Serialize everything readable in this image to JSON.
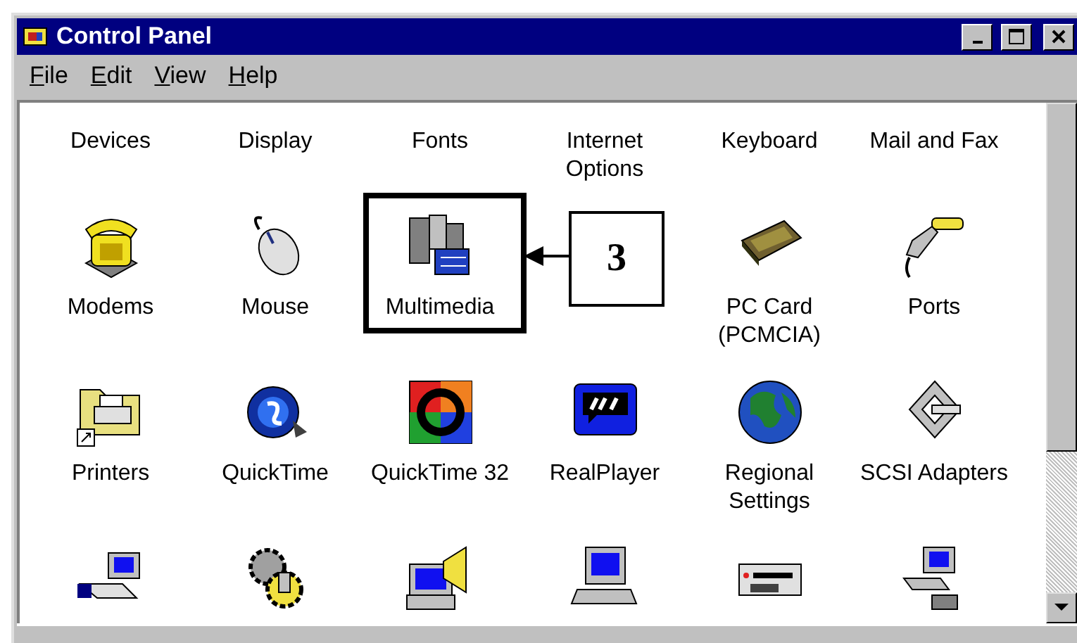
{
  "window": {
    "title": "Control Panel"
  },
  "menu": [
    "File",
    "Edit",
    "View",
    "Help"
  ],
  "rows": [
    {
      "items": [
        {
          "kind": "labeled",
          "label": "Devices"
        },
        {
          "kind": "labeled",
          "label": "Display"
        },
        {
          "kind": "labeled",
          "label": "Fonts"
        },
        {
          "kind": "labeled",
          "label": "Internet Options"
        },
        {
          "kind": "labeled",
          "label": "Keyboard"
        },
        {
          "kind": "labeled",
          "label": "Mail and Fax"
        }
      ]
    },
    {
      "items": [
        {
          "kind": "labeled",
          "label": "Modems"
        },
        {
          "kind": "labeled",
          "label": "Mouse"
        },
        {
          "kind": "labeled",
          "label": "Multimedia",
          "highlighted": true
        },
        {
          "kind": "hidden"
        },
        {
          "kind": "labeled",
          "label": "PC Card (PCMCIA)"
        },
        {
          "kind": "labeled",
          "label": "Ports"
        }
      ]
    },
    {
      "items": [
        {
          "kind": "labeled",
          "label": "Printers"
        },
        {
          "kind": "labeled",
          "label": "QuickTime"
        },
        {
          "kind": "labeled",
          "label": "QuickTime 32"
        },
        {
          "kind": "labeled",
          "label": "RealPlayer"
        },
        {
          "kind": "labeled",
          "label": "Regional Settings"
        },
        {
          "kind": "labeled",
          "label": "SCSI Adapters"
        }
      ]
    },
    {
      "items": [
        {
          "kind": "icon-only"
        },
        {
          "kind": "icon-only"
        },
        {
          "kind": "icon-only"
        },
        {
          "kind": "icon-only"
        },
        {
          "kind": "icon-only"
        },
        {
          "kind": "icon-only"
        }
      ]
    }
  ],
  "callout": {
    "label": "3"
  }
}
